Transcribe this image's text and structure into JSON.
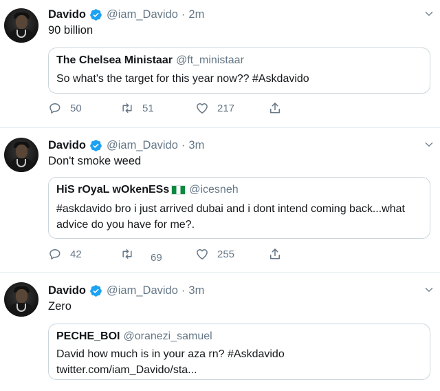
{
  "tweets": [
    {
      "name": "Davido",
      "handle": "@iam_Davido",
      "separator": "·",
      "time": "2m",
      "text": "90 billion",
      "quote": {
        "name": "The Chelsea Ministaar",
        "handle": "@ft_ministaar",
        "lines": [
          "So what's the target for this year now?? #Askdavido"
        ]
      },
      "replies": "50",
      "retweets": "51",
      "likes": "217"
    },
    {
      "name": "Davido",
      "handle": "@iam_Davido",
      "separator": "·",
      "time": "3m",
      "text": "Don't smoke weed",
      "quote": {
        "name": "HiS rOyaL wOkenESs",
        "handle": "@icesneh",
        "lines": [
          "#askdavido bro i just arrived dubai and i dont intend coming back...what",
          "advice do you have for me?."
        ]
      },
      "replies": "42",
      "retweets": "69",
      "likes": "255"
    },
    {
      "name": "Davido",
      "handle": "@iam_Davido",
      "separator": "·",
      "time": "3m",
      "text": "Zero",
      "quote": {
        "name": "PECHE_BOI",
        "handle": "@oranezi_samuel",
        "lines": [
          "David how much is in your aza rn? #Askdavido",
          "twitter.com/iam_Davido/sta..."
        ]
      }
    }
  ],
  "icons": {
    "verified": "verified-badge-icon",
    "caret": "chevron-down-icon",
    "reply": "reply-icon",
    "retweet": "retweet-icon",
    "like": "heart-icon",
    "share": "share-icon",
    "flag": "nigeria-flag-icon"
  },
  "colors": {
    "verified": "#1da1f2",
    "secondary_text": "#657786",
    "border": "#e6ecf0",
    "quote_border": "#ccd6dd"
  }
}
